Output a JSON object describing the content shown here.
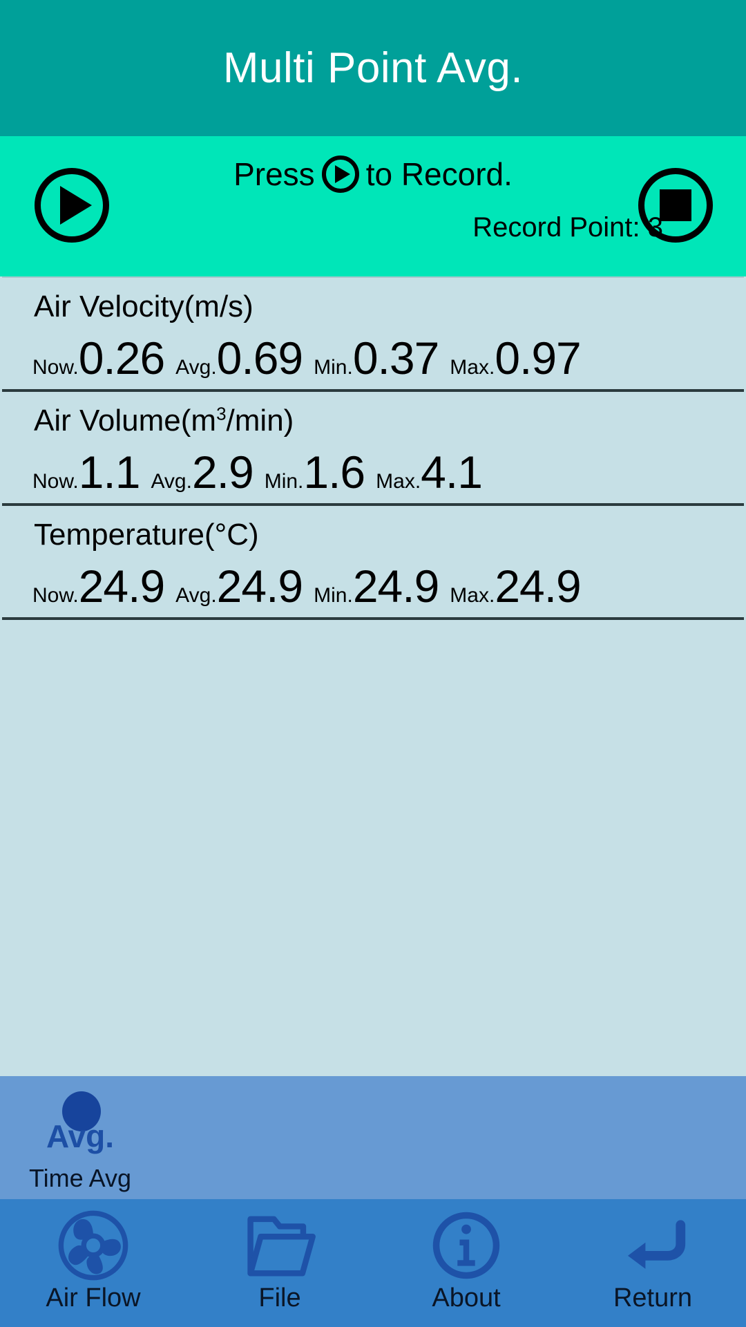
{
  "header": {
    "title": "Multi Point Avg.",
    "bg_color": "#00a099",
    "text_color": "#ffffff"
  },
  "record_bar": {
    "bg_color": "#00e6b8",
    "instruction_prefix": "Press",
    "instruction_suffix": "to Record.",
    "record_point_text": "Record Point: 3",
    "play_button_name": "play",
    "stop_button_name": "stop"
  },
  "measurements": [
    {
      "title_main": "Air Velocity(m/s)",
      "title_pre": "Air Velocity(m/s)",
      "title_sup": "",
      "title_post": "",
      "readings": [
        {
          "label": "Now.",
          "value": "0.26"
        },
        {
          "label": "Avg.",
          "value": "0.69"
        },
        {
          "label": "Min.",
          "value": "0.37"
        },
        {
          "label": "Max.",
          "value": "0.97"
        }
      ]
    },
    {
      "title_main": "Air Volume(m3/min)",
      "title_pre": "Air Volume(m",
      "title_sup": "3",
      "title_post": "/min)",
      "readings": [
        {
          "label": "Now.",
          "value": "1.1"
        },
        {
          "label": "Avg.",
          "value": "2.9"
        },
        {
          "label": "Min.",
          "value": "1.6"
        },
        {
          "label": "Max.",
          "value": "4.1"
        }
      ]
    },
    {
      "title_main": "Temperature(°C)",
      "title_pre": "Temperature(°C)",
      "title_sup": "",
      "title_post": "",
      "readings": [
        {
          "label": "Now.",
          "value": "24.9"
        },
        {
          "label": "Avg.",
          "value": "24.9"
        },
        {
          "label": "Min.",
          "value": "24.9"
        },
        {
          "label": "Max.",
          "value": "24.9"
        }
      ]
    }
  ],
  "mode_bar": {
    "bg_color": "#679ad3",
    "item": {
      "icon_text": "Avg.",
      "icon_name": "avg-dot-icon",
      "label": "Time Avg"
    }
  },
  "nav_bar": {
    "bg_color": "#3380c8",
    "items": [
      {
        "icon": "fan-icon",
        "label": "Air Flow"
      },
      {
        "icon": "folder-icon",
        "label": "File"
      },
      {
        "icon": "info-icon",
        "label": "About"
      },
      {
        "icon": "return-arrow-icon",
        "label": "Return"
      }
    ]
  }
}
